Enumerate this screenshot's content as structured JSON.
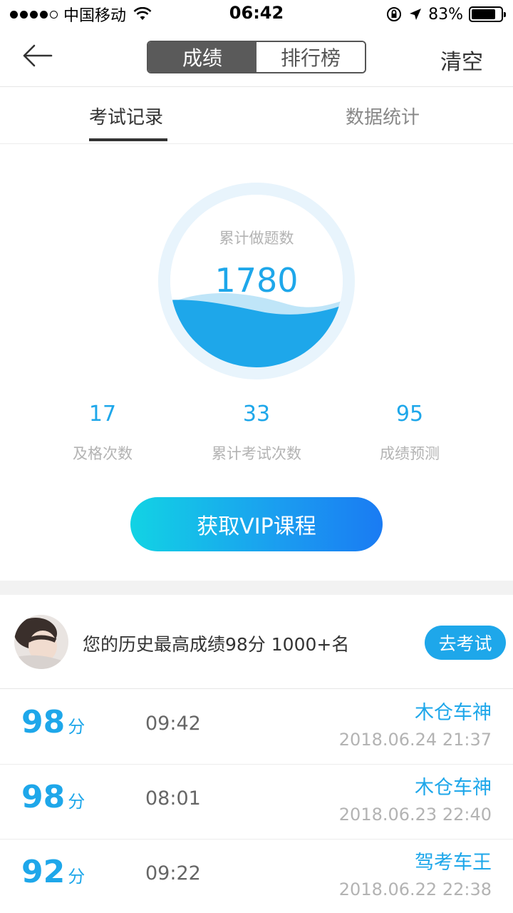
{
  "status_bar": {
    "carrier": "中国移动",
    "time": "06:42",
    "battery_percent": "83%",
    "battery_level": 0.83,
    "icons": [
      "signal-dots-icon",
      "wifi-icon",
      "rotation-lock-icon",
      "location-arrow-icon",
      "battery-icon"
    ]
  },
  "nav": {
    "back_icon": "back-arrow-icon",
    "segments": [
      "成绩",
      "排行榜"
    ],
    "active_segment": 0,
    "clear_label": "清空"
  },
  "tabs": {
    "items": [
      "考试记录",
      "数据统计"
    ],
    "active": 0
  },
  "summary": {
    "label": "累计做题数",
    "value": "1780",
    "colors": {
      "wave_primary": "#1ea7ea",
      "wave_secondary": "#bfe5f8",
      "ring": "#e8f4fc"
    }
  },
  "stats": [
    {
      "value": "17",
      "label": "及格次数"
    },
    {
      "value": "33",
      "label": "累计考试次数"
    },
    {
      "value": "95",
      "label": "成绩预测"
    }
  ],
  "vip_button": {
    "label": "获取VIP课程"
  },
  "best": {
    "text": "您的历史最高成绩98分  1000+名",
    "button_label": "去考试"
  },
  "records": [
    {
      "score": "98",
      "unit": "分",
      "duration": "09:42",
      "name": "木仓车神",
      "date": "2018.06.24 21:37"
    },
    {
      "score": "98",
      "unit": "分",
      "duration": "08:01",
      "name": "木仓车神",
      "date": "2018.06.23 22:40"
    },
    {
      "score": "92",
      "unit": "分",
      "duration": "09:22",
      "name": "驾考车王",
      "date": "2018.06.22 22:38"
    }
  ],
  "colors": {
    "accent": "#1ea7ea",
    "muted": "#b3b3b3"
  }
}
